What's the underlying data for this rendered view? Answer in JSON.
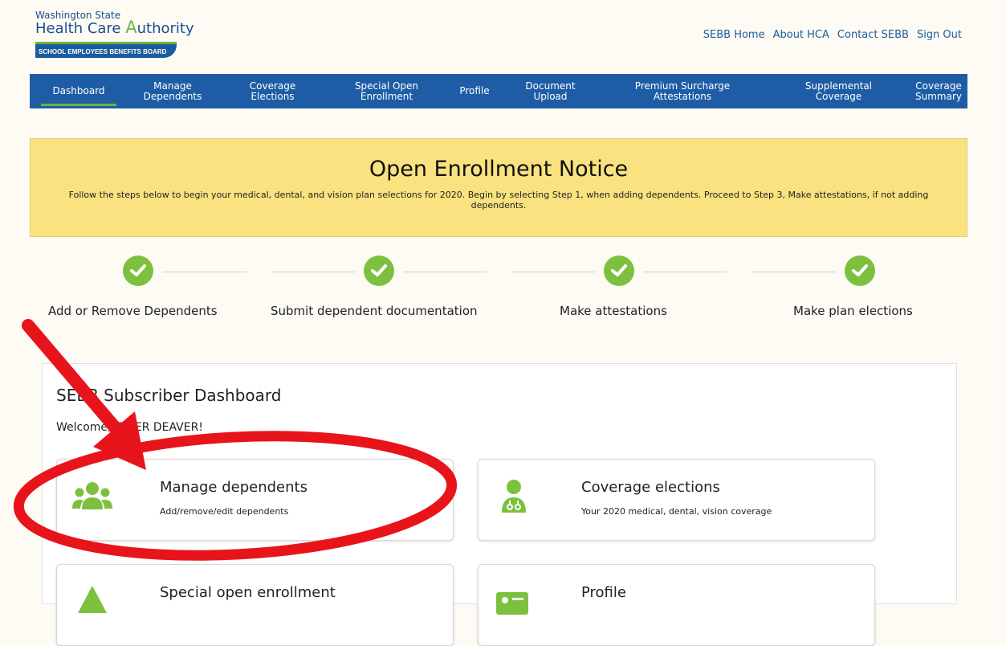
{
  "logo": {
    "line1": "Washington State",
    "line2_prefix": "Health Care ",
    "line2_a": "A",
    "line2_suffix": "uthority",
    "banner": "SCHOOL EMPLOYEES BENEFITS BOARD"
  },
  "toplinks": [
    "SEBB Home",
    "About HCA",
    "Contact SEBB",
    "Sign Out"
  ],
  "nav": {
    "items": [
      {
        "line1": "Dashboard",
        "line2": ""
      },
      {
        "line1": "Manage",
        "line2": "Dependents"
      },
      {
        "line1": "Coverage",
        "line2": "Elections"
      },
      {
        "line1": "Special Open",
        "line2": "Enrollment"
      },
      {
        "line1": "Profile",
        "line2": ""
      },
      {
        "line1": "Document",
        "line2": "Upload"
      },
      {
        "line1": "Premium Surcharge",
        "line2": "Attestations"
      },
      {
        "line1": "Supplemental",
        "line2": "Coverage"
      },
      {
        "line1": "Coverage",
        "line2": "Summary"
      }
    ]
  },
  "notice": {
    "title": "Open Enrollment Notice",
    "text": "Follow the steps below to begin your medical, dental, and vision plan selections for 2020. Begin by selecting Step 1, when adding dependents. Proceed to Step 3, Make attestations, if not adding dependents."
  },
  "steps": [
    {
      "label": "Add or Remove Dependents"
    },
    {
      "label": "Submit dependent documentation"
    },
    {
      "label": "Make attestations"
    },
    {
      "label": "Make plan elections"
    }
  ],
  "dashboard": {
    "title": "SEBB Subscriber Dashboard",
    "welcome": "Welcome, TYLER DEAVER!",
    "cards": [
      {
        "title": "Manage dependents",
        "desc": "Add/remove/edit dependents",
        "icon": "users-icon"
      },
      {
        "title": "Coverage elections",
        "desc": "Your 2020 medical, dental, vision coverage",
        "icon": "doctor-icon"
      },
      {
        "title": "Special open enrollment",
        "desc": "",
        "icon": "triangle-icon"
      },
      {
        "title": "Profile",
        "desc": "",
        "icon": "profile-card-icon"
      }
    ]
  },
  "colors": {
    "nav_bg": "#1e5da5",
    "accent_green": "#7cc13e",
    "notice_bg": "#f9e27f",
    "annotation_red": "#e8141b",
    "link_blue": "#1a5c9e"
  }
}
